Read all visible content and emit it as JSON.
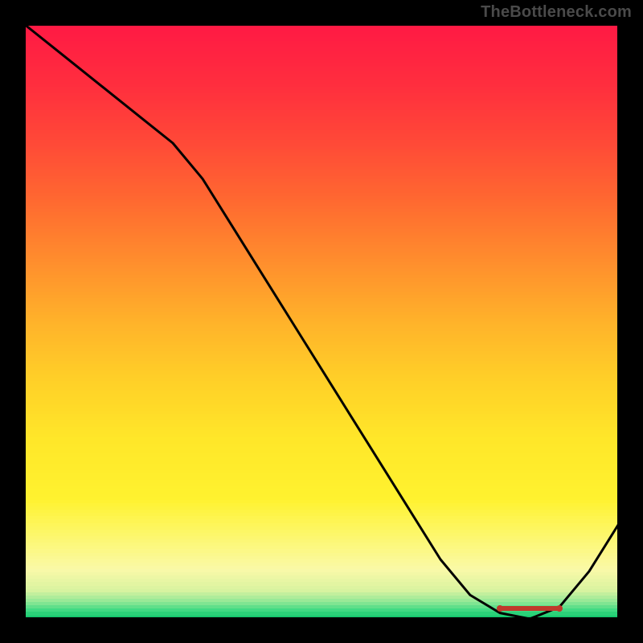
{
  "watermark": "TheBottleneck.com",
  "chart_data": {
    "type": "line",
    "title": "",
    "xlabel": "",
    "ylabel": "",
    "xlim": [
      0,
      100
    ],
    "ylim": [
      0,
      100
    ],
    "x": [
      0,
      5,
      10,
      15,
      20,
      25,
      30,
      35,
      40,
      45,
      50,
      55,
      60,
      65,
      70,
      75,
      80,
      85,
      90,
      95,
      100
    ],
    "values": [
      100,
      96,
      92,
      88,
      84,
      80,
      74,
      66,
      58,
      50,
      42,
      34,
      26,
      18,
      10,
      4,
      1,
      0,
      2,
      8,
      16
    ],
    "optimal_range_x": [
      80,
      90
    ],
    "gradient_stops": [
      {
        "pos": 0.0,
        "color": "#ff1a44"
      },
      {
        "pos": 0.1,
        "color": "#ff2e3e"
      },
      {
        "pos": 0.2,
        "color": "#ff4a37"
      },
      {
        "pos": 0.3,
        "color": "#ff6a30"
      },
      {
        "pos": 0.4,
        "color": "#ff8e2d"
      },
      {
        "pos": 0.5,
        "color": "#ffb22a"
      },
      {
        "pos": 0.6,
        "color": "#ffd028"
      },
      {
        "pos": 0.7,
        "color": "#ffe729"
      },
      {
        "pos": 0.8,
        "color": "#fff22f"
      },
      {
        "pos": 0.86,
        "color": "#fdf76a"
      },
      {
        "pos": 0.92,
        "color": "#faf9a8"
      },
      {
        "pos": 0.955,
        "color": "#d8f3a0"
      },
      {
        "pos": 0.975,
        "color": "#8ee796"
      },
      {
        "pos": 0.99,
        "color": "#3bd981"
      },
      {
        "pos": 1.0,
        "color": "#17c96f"
      }
    ]
  },
  "colors": {
    "frame": "#000000",
    "curve": "#000000",
    "marker": "#c0392b",
    "watermark": "#4a4a4a"
  }
}
